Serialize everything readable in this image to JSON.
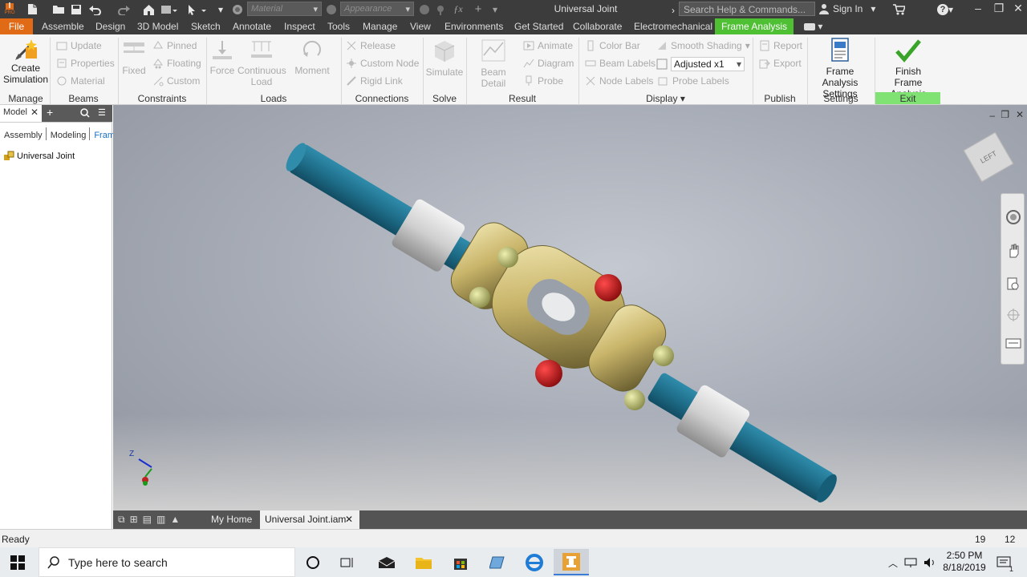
{
  "title_bar": {
    "doc_title": "Universal Joint",
    "material_placeholder": "Material",
    "appearance_placeholder": "Appearance",
    "search_placeholder": "Search Help & Commands...",
    "sign_in": "Sign In",
    "pro_badge": "PRO"
  },
  "menu": {
    "file": "File",
    "tabs": [
      "Assemble",
      "Design",
      "3D Model",
      "Sketch",
      "Annotate",
      "Inspect",
      "Tools",
      "Manage",
      "View",
      "Environments",
      "Get Started",
      "Collaborate",
      "Electromechanical",
      "Frame Analysis"
    ]
  },
  "ribbon": {
    "manage": {
      "create_line1": "Create",
      "create_line2": "Simulation",
      "label": "Manage"
    },
    "beams": {
      "update": "Update",
      "properties": "Properties",
      "material": "Material",
      "label": "Beams"
    },
    "constraints": {
      "fixed": "Fixed",
      "pinned": "Pinned",
      "floating": "Floating",
      "custom": "Custom",
      "label": "Constraints"
    },
    "loads": {
      "force": "Force",
      "continuous_line1": "Continuous",
      "continuous_line2": "Load",
      "moment": "Moment",
      "label": "Loads"
    },
    "connections": {
      "release": "Release",
      "custom_node": "Custom Node",
      "rigid_link": "Rigid Link",
      "label": "Connections"
    },
    "solve": {
      "simulate": "Simulate",
      "label": "Solve"
    },
    "result": {
      "beam_detail": "Beam Detail",
      "animate": "Animate",
      "diagram": "Diagram",
      "probe": "Probe",
      "label": "Result"
    },
    "display": {
      "color_bar": "Color Bar",
      "beam_labels": "Beam Labels",
      "node_labels": "Node Labels",
      "smooth_shading": "Smooth Shading",
      "adjusted": "Adjusted x1",
      "probe_labels": "Probe Labels",
      "label": "Display"
    },
    "publish": {
      "report": "Report",
      "export": "Export",
      "label": "Publish"
    },
    "settings": {
      "line1": "Frame Analysis",
      "line2": "Settings",
      "label": "Settings"
    },
    "exit": {
      "line1": "Finish",
      "line2": "Frame Analysis",
      "label": "Exit"
    }
  },
  "browser": {
    "tab_model": "Model",
    "tabs": [
      "Assembly",
      "Modeling",
      "Frame"
    ],
    "root": "Universal Joint"
  },
  "viewcube": {
    "face": "LEFT"
  },
  "doc_tabs": {
    "home": "My Home",
    "active": "Universal Joint.iam"
  },
  "status": {
    "text": "Ready",
    "n1": "19",
    "n2": "12"
  },
  "taskbar": {
    "search": "Type here to search",
    "time": "2:50 PM",
    "date": "8/18/2019",
    "notif": "1"
  },
  "colors": {
    "accent": "#e06a15",
    "frame_analysis": "#4fbf34",
    "shaft": "#1f6f8b",
    "yoke": "#c9b56a",
    "bolt": "#c0181a"
  }
}
